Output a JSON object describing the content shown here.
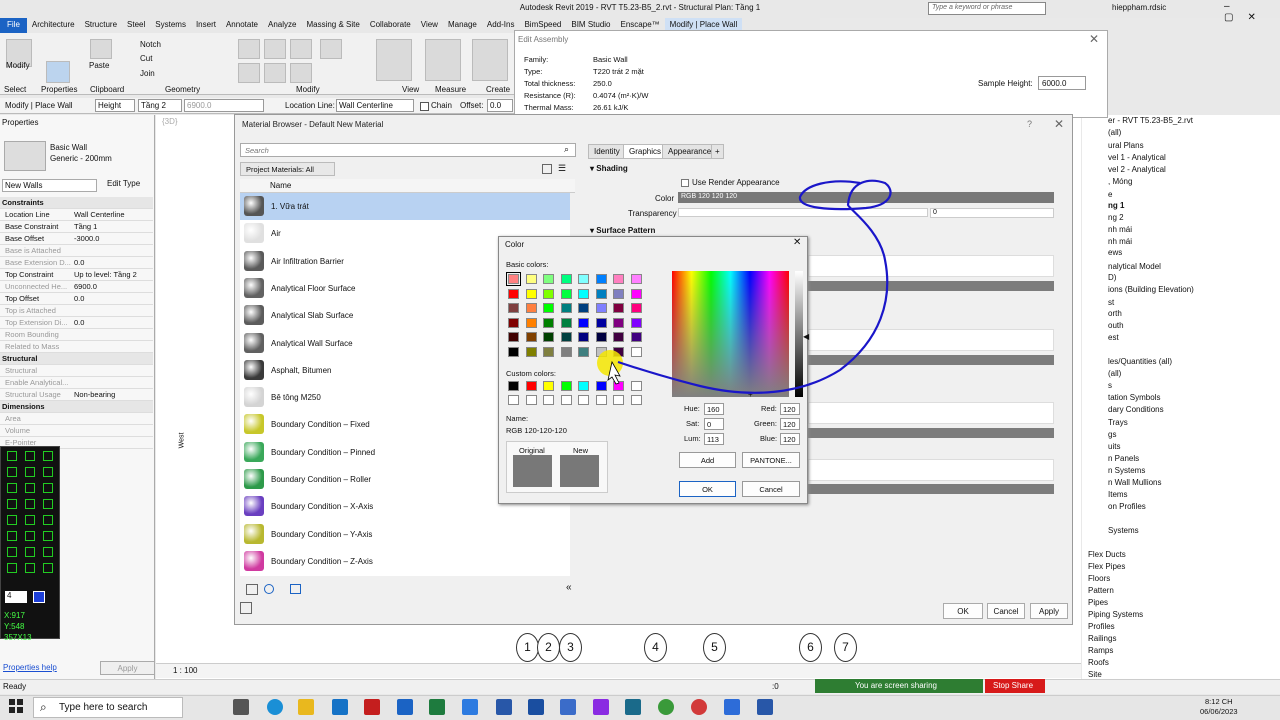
{
  "window": {
    "title": "Autodesk Revit 2019 - RVT T5.23-B5_2.rvt - Structural Plan: Tầng 1",
    "search_placeholder": "Type a keyword or phrase",
    "user": "hieppham.rdsic"
  },
  "menu": [
    "File",
    "Architecture",
    "Structure",
    "Steel",
    "Systems",
    "Insert",
    "Annotate",
    "Analyze",
    "Massing & Site",
    "Collaborate",
    "View",
    "Manage",
    "Add-Ins",
    "BimSpeed",
    "BIM Studio",
    "Enscape™",
    "Modify | Place Wall"
  ],
  "ribbon": {
    "tools": [
      "Cut",
      "Join",
      "Notch",
      "Paste",
      "Copy"
    ],
    "panels": [
      "Select",
      "Properties",
      "Clipboard",
      "Geometry",
      "Modify",
      "View",
      "Measure",
      "Create"
    ],
    "modify_label": "Modify"
  },
  "optbar": {
    "context": "Modify | Place Wall",
    "height_label": "Height",
    "level": "Tầng 2",
    "height_value": "6900.0",
    "location_line_label": "Location Line:",
    "location_line": "Wall Centerline",
    "chain": "Chain",
    "offset_label": "Offset:",
    "offset": "0.0"
  },
  "properties": {
    "title": "Properties",
    "type_name": "Basic Wall",
    "type_sub": "Generic - 200mm",
    "instance": "New Walls",
    "edit_type": "Edit Type",
    "rows": [
      {
        "k": "Constraints",
        "v": "",
        "sec": true
      },
      {
        "k": "Location Line",
        "v": "Wall Centerline"
      },
      {
        "k": "Base Constraint",
        "v": "Tầng 1"
      },
      {
        "k": "Base Offset",
        "v": "-3000.0"
      },
      {
        "k": "Base is Attached",
        "v": "",
        "dis": true
      },
      {
        "k": "Base Extension D...",
        "v": "0.0",
        "dis": true
      },
      {
        "k": "Top Constraint",
        "v": "Up to level: Tầng 2"
      },
      {
        "k": "Unconnected He...",
        "v": "6900.0",
        "dis": true
      },
      {
        "k": "Top Offset",
        "v": "0.0"
      },
      {
        "k": "Top is Attached",
        "v": "",
        "dis": true
      },
      {
        "k": "Top Extension Di...",
        "v": "0.0",
        "dis": true
      },
      {
        "k": "Room Bounding",
        "v": "",
        "dis": true
      },
      {
        "k": "Related to Mass",
        "v": "",
        "dis": true
      },
      {
        "k": "Structural",
        "v": "",
        "sec": true
      },
      {
        "k": "Structural",
        "v": "",
        "dis": true
      },
      {
        "k": "Enable Analytical...",
        "v": "",
        "dis": true
      },
      {
        "k": "Structural Usage",
        "v": "Non-bearing",
        "dis": true
      },
      {
        "k": "Dimensions",
        "v": "",
        "sec": true
      },
      {
        "k": "Area",
        "v": "",
        "dis": true
      },
      {
        "k": "Volume",
        "v": "",
        "dis": true
      },
      {
        "k": "E-Pointer",
        "v": "",
        "dis": true
      }
    ],
    "help_link": "Properties help",
    "apply": "Apply",
    "coord_x": "X:917",
    "coord_y": "Y:548",
    "coord_size": "357X13",
    "combo_value": "4"
  },
  "edit_assembly": {
    "title": "Edit Assembly",
    "family_label": "Family:",
    "family": "Basic Wall",
    "type_label": "Type:",
    "type": "T220 trát 2 mặt",
    "thickness_label": "Total thickness:",
    "thickness": "250.0",
    "resistance_label": "Resistance (R):",
    "resistance": "0.4074 (m²·K)/W",
    "mass_label": "Thermal Mass:",
    "mass": "26.61 kJ/K",
    "sample_label": "Sample Height:",
    "sample": "6000.0"
  },
  "material_browser": {
    "title": "Material Browser - Default New Material",
    "search_placeholder": "Search",
    "project_materials": "Project Materials: All",
    "col_name": "Name",
    "materials": [
      {
        "name": "1. Vữa trát",
        "color": "#555555"
      },
      {
        "name": "Air",
        "color": "#e0e0e0"
      },
      {
        "name": "Air Infiltration Barrier",
        "color": "#5a5a5a"
      },
      {
        "name": "Analytical Floor Surface",
        "color": "#626262"
      },
      {
        "name": "Analytical Slab Surface",
        "color": "#5c5c5c"
      },
      {
        "name": "Analytical Wall Surface",
        "color": "#606060"
      },
      {
        "name": "Asphalt, Bitumen",
        "color": "#3a3a3a"
      },
      {
        "name": "Bê tông M250",
        "color": "#d4d4d4"
      },
      {
        "name": "Boundary Condition – Fixed",
        "color": "#c7c72a"
      },
      {
        "name": "Boundary Condition – Pinned",
        "color": "#3aa85a"
      },
      {
        "name": "Boundary Condition – Roller",
        "color": "#2e9a4a"
      },
      {
        "name": "Boundary Condition – X-Axis",
        "color": "#6a3fc0"
      },
      {
        "name": "Boundary Condition – Y-Axis",
        "color": "#b8b830"
      },
      {
        "name": "Boundary Condition – Z-Axis",
        "color": "#d03aa0"
      }
    ],
    "tabs": [
      "Identity",
      "Graphics",
      "Appearance",
      "+"
    ],
    "shading": "Shading",
    "use_render": "Use Render Appearance",
    "color_label": "Color",
    "color_value": "RGB 120 120 120",
    "transparency_label": "Transparency",
    "transparency": "0",
    "surface_pattern": "Surface Pattern",
    "ok": "OK",
    "cancel": "Cancel",
    "apply": "Apply"
  },
  "color_dialog": {
    "title": "Color",
    "basic_colors": "Basic colors:",
    "custom_colors": "Custom colors:",
    "name_label": "Name:",
    "name_value": "RGB 120-120-120",
    "original": "Original",
    "new": "New",
    "hue_label": "Hue:",
    "hue": "160",
    "sat_label": "Sat:",
    "sat": "0",
    "lum_label": "Lum:",
    "lum": "113",
    "red_label": "Red:",
    "red": "120",
    "green_label": "Green:",
    "green": "120",
    "blue_label": "Blue:",
    "blue": "120",
    "add": "Add",
    "pantone": "PANTONE...",
    "ok": "OK",
    "cancel": "Cancel",
    "basic_swatches": [
      "#ff8080",
      "#ffff80",
      "#80ff80",
      "#00ff80",
      "#80ffff",
      "#0080ff",
      "#ff80c0",
      "#ff80ff",
      "#ff0000",
      "#ffff00",
      "#80ff00",
      "#00ff40",
      "#00ffff",
      "#0080c0",
      "#8080c0",
      "#ff00ff",
      "#804040",
      "#ff8040",
      "#00ff00",
      "#008080",
      "#004080",
      "#8080ff",
      "#800040",
      "#ff0080",
      "#800000",
      "#ff8000",
      "#008000",
      "#008040",
      "#0000ff",
      "#0000a0",
      "#800080",
      "#8000ff",
      "#400000",
      "#804000",
      "#004000",
      "#004040",
      "#000080",
      "#000040",
      "#400040",
      "#400080",
      "#000000",
      "#808000",
      "#808040",
      "#808080",
      "#408080",
      "#c0c0c0",
      "#400040",
      "#ffffff"
    ],
    "custom_swatches": [
      "#000000",
      "#ff0000",
      "#ffff00",
      "#00ff00",
      "#00ffff",
      "#0000ff",
      "#ff00ff",
      "#ffffff",
      "#ffffff",
      "#ffffff",
      "#ffffff",
      "#ffffff",
      "#ffffff",
      "#ffffff",
      "#ffffff",
      "#ffffff"
    ],
    "original_color": "#787878",
    "new_color": "#787878"
  },
  "project_tree": {
    "items": [
      "er - RVT T5.23-B5_2.rvt",
      "(all)",
      "ural Plans",
      "vel 1 - Analytical",
      "vel 2 - Analytical",
      ", Móng",
      "e",
      "ng 1",
      "ng 2",
      "nh mái",
      "nh mái",
      "ews",
      "nalytical Model",
      "D)",
      "ions (Building Elevation)",
      "st",
      "orth",
      "outh",
      "est",
      "les/Quantities (all)",
      "(all)",
      "s",
      "tation Symbols",
      "dary Conditions",
      "Trays",
      "gs",
      "uits",
      "n Panels",
      "n Systems",
      "n Wall Mullions",
      "Items",
      "on Profiles",
      "Systems",
      "Flex Ducts",
      "Flex Pipes",
      "Floors",
      "Pattern",
      "Pipes",
      "Piping Systems",
      "Profiles",
      "Railings",
      "Ramps",
      "Roofs",
      "Site"
    ]
  },
  "grid_bubbles": [
    "1",
    "2",
    "3",
    "4",
    "5",
    "6",
    "7"
  ],
  "view": {
    "scale": "1 : 100",
    "west": "West",
    "tab_3d": "{3D}"
  },
  "status": {
    "ready": "Ready",
    "zero": ":0",
    "sharing": "You are screen sharing",
    "stop_share": "Stop Share"
  },
  "taskbar": {
    "search": "Type here to search",
    "time": "8:12 CH",
    "date": "06/06/2023"
  }
}
